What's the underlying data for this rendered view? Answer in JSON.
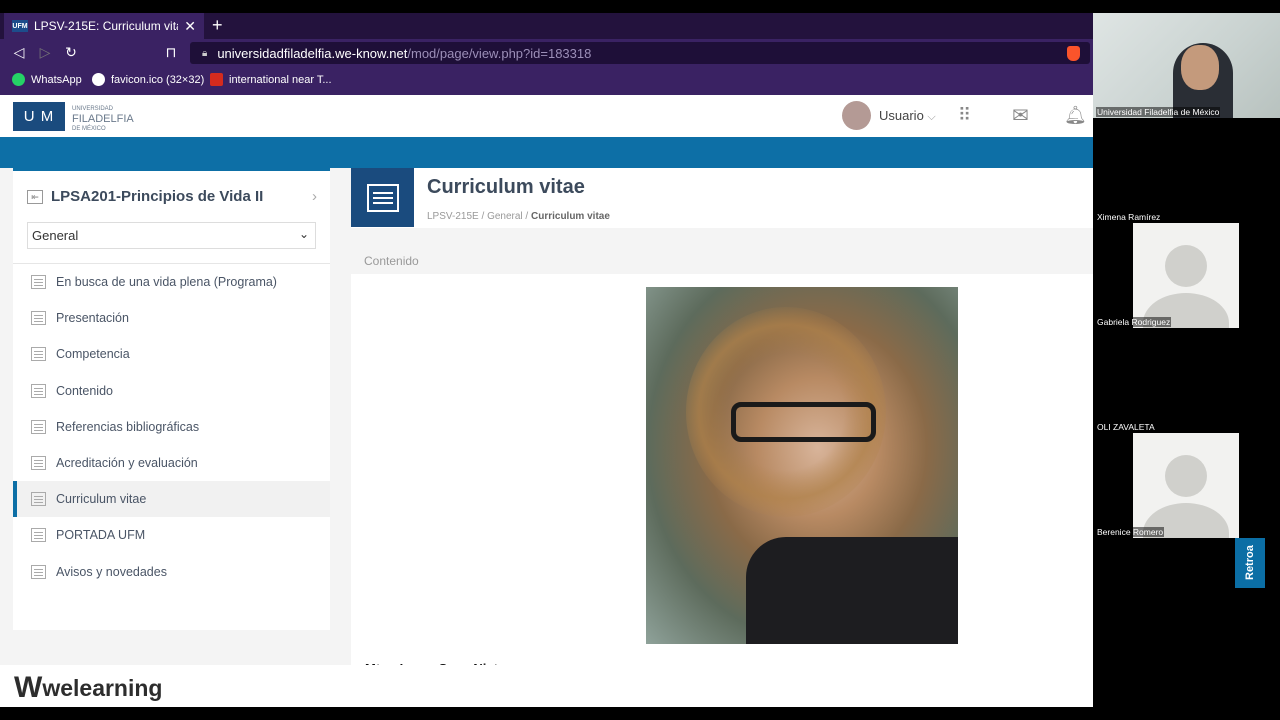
{
  "browser": {
    "tab_title": "LPSV-215E: Curriculum vitae",
    "tab_favicon": "UFM",
    "url_host": "universidadfiladelfia.we-know.net",
    "url_path": "/mod/page/view.php?id=183318",
    "bookmarks": [
      {
        "label": "WhatsApp",
        "icon": "whatsapp-icon",
        "color": "#25d366"
      },
      {
        "label": "favicon.ico (32×32)",
        "icon": "google-icon",
        "color": "#ffffff"
      },
      {
        "label": "international near T...",
        "icon": "maple-leaf-icon",
        "color": "#d52b1e"
      }
    ]
  },
  "header": {
    "logo": "U M",
    "logo_sub1": "UNIVERSIDAD",
    "logo_sub2": "FILADELFIA",
    "logo_sub3": "DE MÉXICO",
    "user_label": "Usuario",
    "user_chevron": "⌵"
  },
  "sidebar": {
    "course_title": "LPSA201-Principios de Vida II",
    "section_select": "General",
    "items": [
      {
        "label": "En busca de una vida plena (Programa)"
      },
      {
        "label": "Presentación"
      },
      {
        "label": "Competencia"
      },
      {
        "label": "Contenido"
      },
      {
        "label": "Referencias bibliográficas"
      },
      {
        "label": "Acreditación y evaluación"
      },
      {
        "label": "Curriculum vitae",
        "active": true
      },
      {
        "label": "PORTADA UFM"
      },
      {
        "label": "Avisos y novedades"
      }
    ]
  },
  "main": {
    "title": "Curriculum vitae",
    "breadcrumb": [
      "LPSV-215E",
      "General",
      "Curriculum vitae"
    ],
    "section_label": "Contenido",
    "name_partial": "Mtra. Laura Sosa Nieto"
  },
  "footer": {
    "brand": "welearning"
  },
  "video_panel": {
    "participants": [
      {
        "name": "Universidad Filadelfia de México",
        "video": true
      },
      {
        "name": "Ximena Ramírez",
        "video": false
      },
      {
        "name": "Gabriela Rodriguez",
        "video": false
      },
      {
        "name": "OLI ZAVALETA",
        "video": false
      },
      {
        "name": "Berenice Romero",
        "video": false
      }
    ],
    "retro_label": "Retroa"
  },
  "colors": {
    "accent_blue": "#0d6fa6",
    "brand_navy": "#1a4b7e",
    "browser_purple": "#3a2263"
  }
}
